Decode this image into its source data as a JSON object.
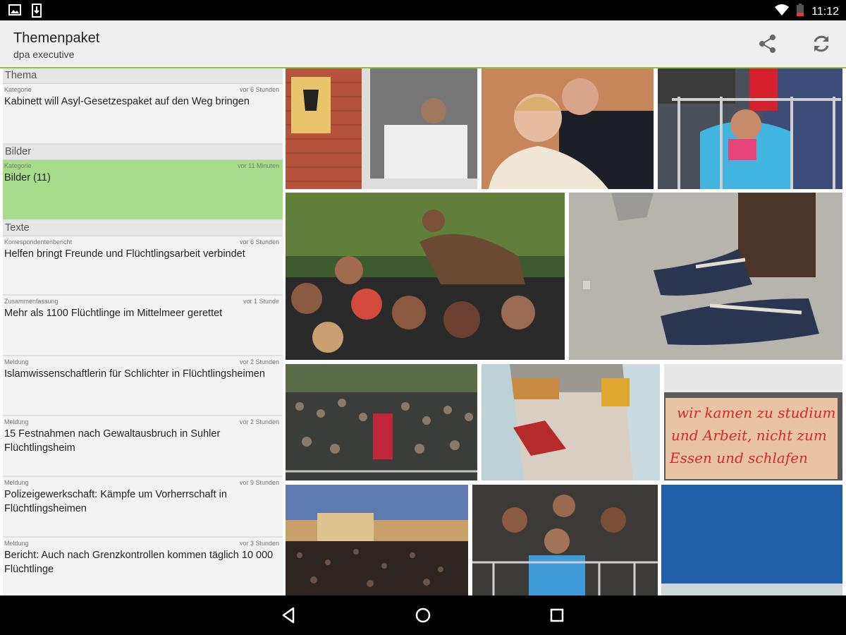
{
  "status": {
    "time": "11:12"
  },
  "header": {
    "title": "Themenpaket",
    "subtitle": "dpa executive"
  },
  "sections": [
    {
      "title": "Thema",
      "items": [
        {
          "category": "Kategorie",
          "time": "vor 6 Stunden",
          "headline": "Kabinett will Asyl-Gesetzespaket auf den Weg bringen"
        }
      ]
    },
    {
      "title": "Bilder",
      "items": [
        {
          "category": "Kategorie",
          "time": "vor 11 Minuten",
          "headline": "Bilder (11)",
          "selected": true
        }
      ]
    },
    {
      "title": "Texte",
      "items": [
        {
          "category": "Korrespondentenbericht",
          "time": "vor 6 Stunden",
          "headline": "Helfen bringt Freunde und Flüchtlingsarbeit verbindet"
        },
        {
          "category": "Zusammenfassung",
          "time": "vor 1 Stunde",
          "headline": "Mehr als 1100 Flüchtlinge im Mittelmeer gerettet"
        },
        {
          "category": "Meldung",
          "time": "vor 2 Stunden",
          "headline": "Islamwissenschaftlerin für Schlichter in Flüchtlingsheimen"
        },
        {
          "category": "Meldung",
          "time": "vor 2 Stunden",
          "headline": "15 Festnahmen nach Gewaltausbruch in Suhler Flüchtlingsheim"
        },
        {
          "category": "Meldung",
          "time": "vor 9 Stunden",
          "headline": "Polizeigewerkschaft: Kämpfe um Vorherrschaft in Flüchtlingsheimen"
        },
        {
          "category": "Meldung",
          "time": "vor 3 Stunden",
          "headline": "Bericht: Auch nach Grenzkontrollen kommen täglich 10 000 Flüchtlinge"
        }
      ]
    }
  ],
  "photos": {
    "sign_text": [
      "wir kamen zu studium",
      "und Arbeit, nicht zum",
      "Essen und schlafen"
    ]
  },
  "colors": {
    "accent": "#8bc34a",
    "selected": "#a6dc8a"
  }
}
